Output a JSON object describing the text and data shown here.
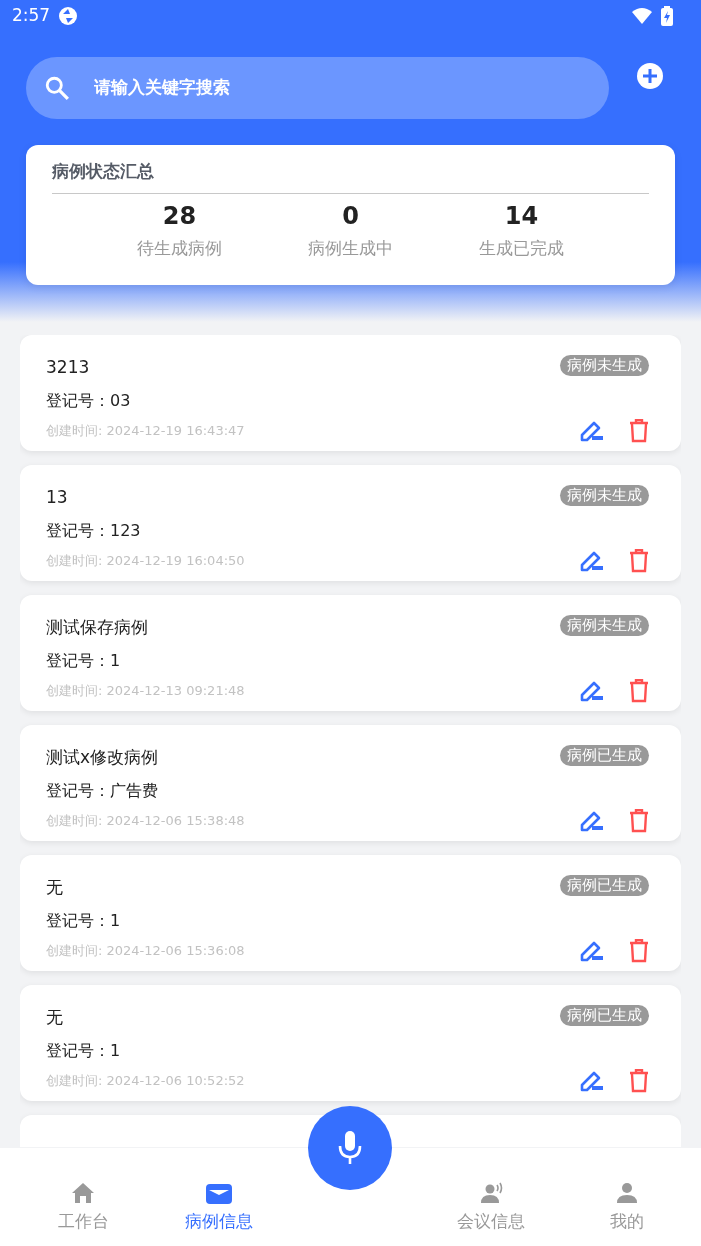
{
  "status_bar": {
    "time": "2:57"
  },
  "search": {
    "placeholder": "请输入关键字搜索"
  },
  "summary": {
    "title": "病例状态汇总",
    "stats": [
      {
        "value": "28",
        "label": "待生成病例"
      },
      {
        "value": "0",
        "label": "病例生成中"
      },
      {
        "value": "14",
        "label": "生成已完成"
      }
    ]
  },
  "cases": [
    {
      "title": "3213",
      "register": "登记号：03",
      "created": "创建时间: 2024-12-19 16:43:47",
      "status": "病例未生成"
    },
    {
      "title": "13",
      "register": "登记号：123",
      "created": "创建时间: 2024-12-19 16:04:50",
      "status": "病例未生成"
    },
    {
      "title": "测试保存病例",
      "register": "登记号：1",
      "created": "创建时间: 2024-12-13 09:21:48",
      "status": "病例未生成"
    },
    {
      "title": "测试x修改病例",
      "register": "登记号：广告费",
      "created": "创建时间: 2024-12-06 15:38:48",
      "status": "病例已生成"
    },
    {
      "title": "无",
      "register": "登记号：1",
      "created": "创建时间: 2024-12-06 15:36:08",
      "status": "病例已生成"
    },
    {
      "title": "无",
      "register": "登记号：1",
      "created": "创建时间: 2024-12-06 10:52:52",
      "status": "病例已生成"
    },
    {
      "kind": "cut"
    }
  ],
  "tabs": [
    {
      "kind": "tab",
      "label": "工作台",
      "selected": false
    },
    {
      "kind": "tab",
      "label": "病例信息",
      "selected": true
    },
    {
      "kind": "mic"
    },
    {
      "kind": "tab",
      "label": "会议信息",
      "selected": false
    },
    {
      "kind": "tab",
      "label": "我的",
      "selected": false
    }
  ]
}
